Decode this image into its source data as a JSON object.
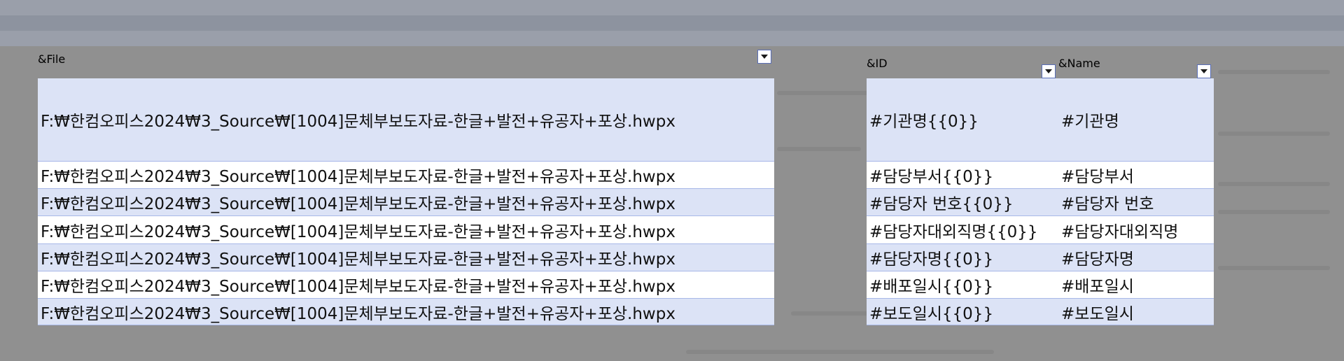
{
  "left_table": {
    "header": "&File",
    "rows": [
      "F:₩한컴오피스2024₩3_Source₩[1004]문체부보도자료-한글+발전+유공자+포상.hwpx",
      "F:₩한컴오피스2024₩3_Source₩[1004]문체부보도자료-한글+발전+유공자+포상.hwpx",
      "F:₩한컴오피스2024₩3_Source₩[1004]문체부보도자료-한글+발전+유공자+포상.hwpx",
      "F:₩한컴오피스2024₩3_Source₩[1004]문체부보도자료-한글+발전+유공자+포상.hwpx",
      "F:₩한컴오피스2024₩3_Source₩[1004]문체부보도자료-한글+발전+유공자+포상.hwpx",
      "F:₩한컴오피스2024₩3_Source₩[1004]문체부보도자료-한글+발전+유공자+포상.hwpx",
      "F:₩한컴오피스2024₩3_Source₩[1004]문체부보도자료-한글+발전+유공자+포상.hwpx"
    ]
  },
  "right_table": {
    "header_id": "&ID",
    "header_name": "&Name",
    "rows": [
      {
        "id": "#기관명{{0}}",
        "name": "#기관명"
      },
      {
        "id": "#담당부서{{0}}",
        "name": "#담당부서"
      },
      {
        "id": "#담당자 번호{{0}}",
        "name": "#담당자 번호"
      },
      {
        "id": "#담당자대외직명{{0}}",
        "name": "#담당자대외직명"
      },
      {
        "id": "#담당자명{{0}}",
        "name": "#담당자명"
      },
      {
        "id": "#배포일시{{0}}",
        "name": "#배포일시"
      },
      {
        "id": "#보도일시{{0}}",
        "name": "#보도일시"
      }
    ]
  },
  "colors": {
    "header_bg": "#6f86cf",
    "band_row": "#dce3f6",
    "plain_row": "#ffffff",
    "background": "#909090"
  }
}
